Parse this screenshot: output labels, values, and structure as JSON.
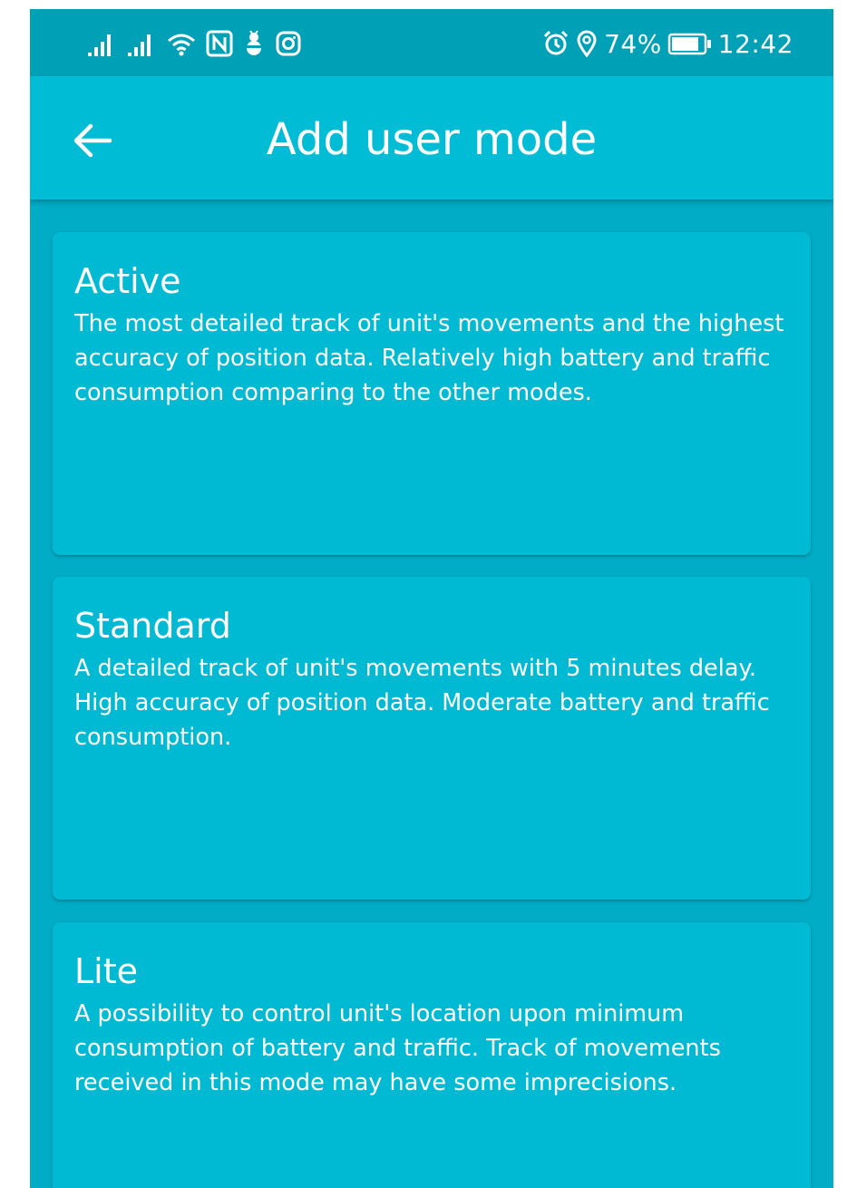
{
  "status_bar": {
    "battery_percent": "74%",
    "time": "12:42",
    "icons_left": [
      "signal-icon",
      "signal-icon",
      "wifi-icon",
      "nfc-icon",
      "bug-icon",
      "instagram-icon"
    ],
    "icons_right": [
      "alarm-icon",
      "location-icon",
      "battery-icon"
    ]
  },
  "header": {
    "back_icon": "arrow-left-icon",
    "title": "Add user mode"
  },
  "modes": [
    {
      "title": "Active",
      "description": "The most detailed track of unit's movements and the highest accuracy of position data. Relatively high battery and traffic consumption comparing to the other modes."
    },
    {
      "title": "Standard",
      "description": "A detailed track of unit's movements with 5 minutes delay. High accuracy of position data. Moderate battery and traffic consumption."
    },
    {
      "title": "Lite",
      "description": "A possibility to control unit's location upon minimum consumption of battery and traffic. Track of movements received in this mode may have some imprecisions."
    }
  ],
  "colors": {
    "status_bar": "#00a1b6",
    "app_bar": "#00bcd4",
    "background": "#00acc6",
    "card": "#00bad3",
    "text": "#ffffff"
  }
}
